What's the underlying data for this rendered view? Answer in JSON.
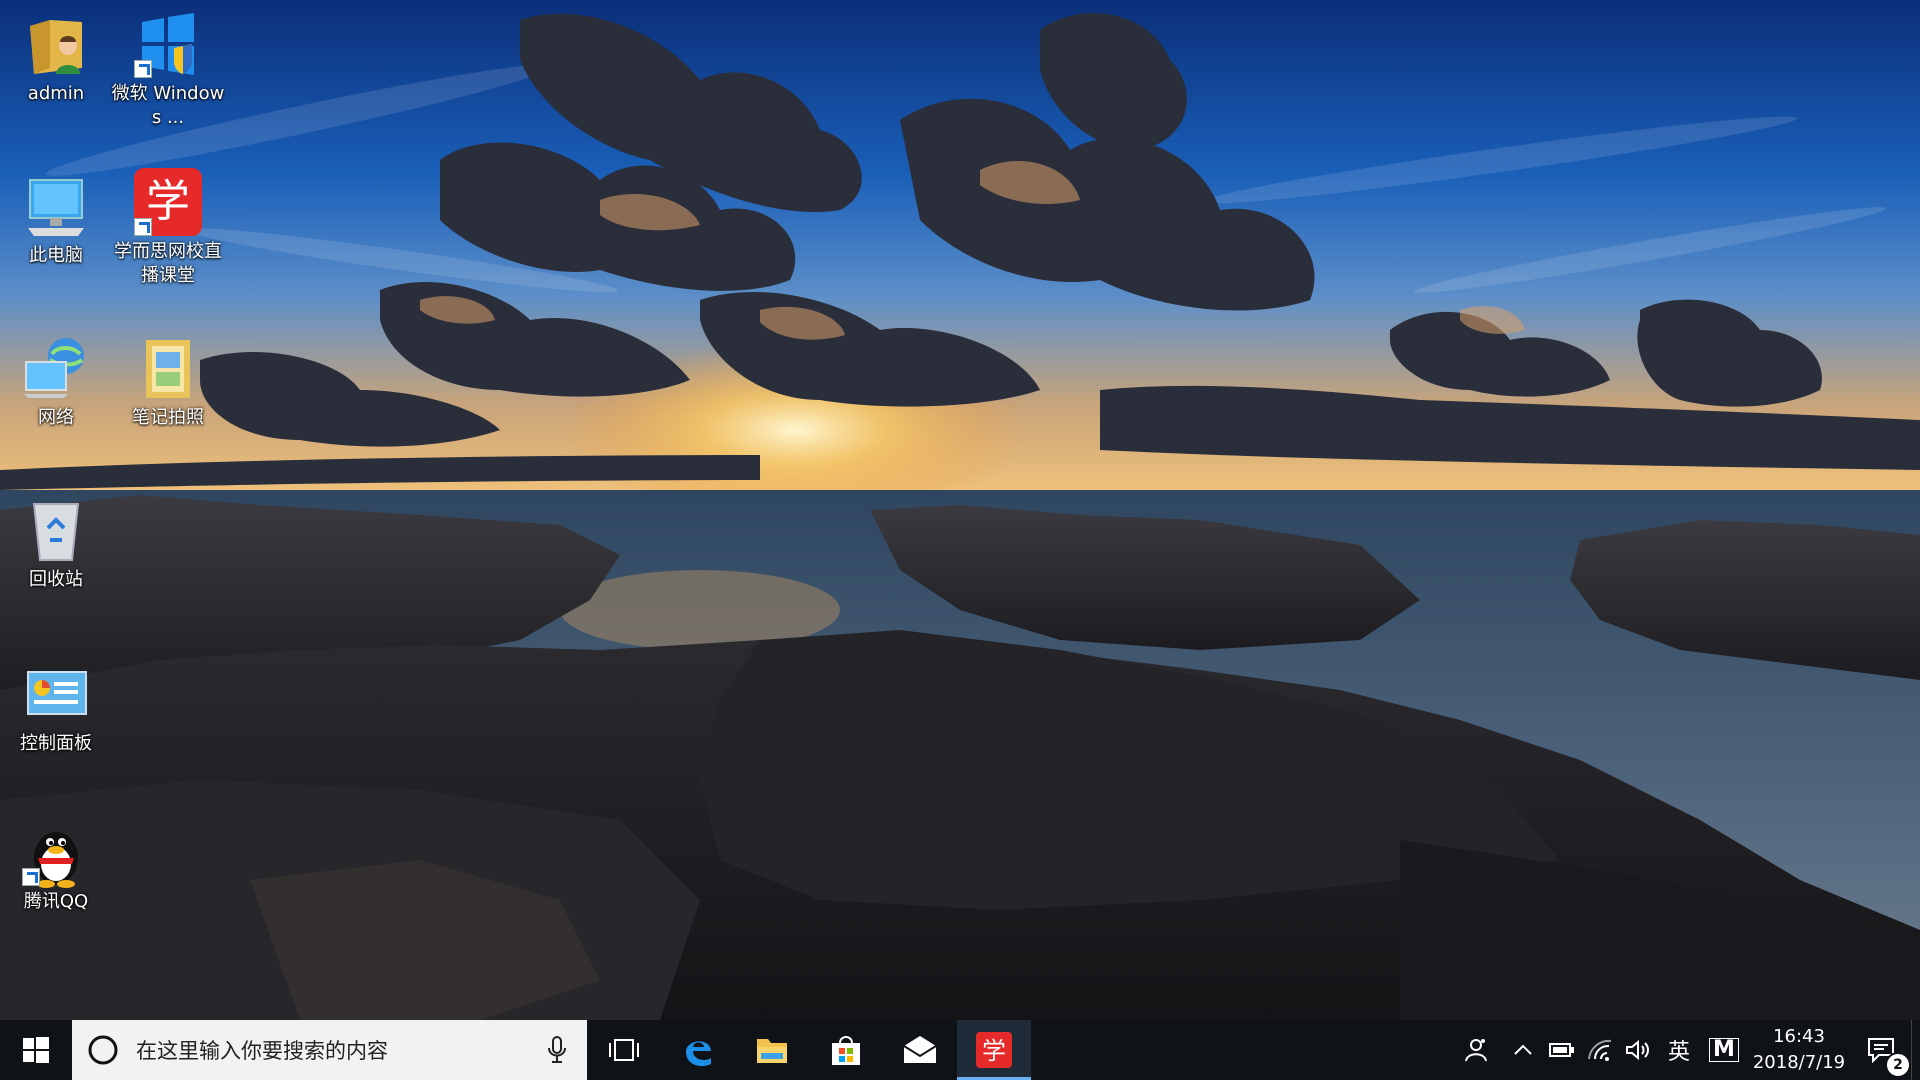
{
  "desktop": {
    "icons": [
      {
        "name": "admin",
        "label": "admin"
      },
      {
        "name": "windows-security",
        "label": "微软 Windows ..."
      },
      {
        "name": "this-pc",
        "label": "此电脑"
      },
      {
        "name": "xueersi",
        "label": "学而思网校直播课堂",
        "glyph": "学"
      },
      {
        "name": "network",
        "label": "网络"
      },
      {
        "name": "note-photo",
        "label": "笔记拍照"
      },
      {
        "name": "recycle-bin",
        "label": "回收站"
      },
      {
        "name": "control-panel",
        "label": "控制面板"
      },
      {
        "name": "qq",
        "label": "腾讯QQ"
      }
    ]
  },
  "taskbar": {
    "search_placeholder": "在这里输入你要搜索的内容",
    "apps": [
      {
        "name": "task-view",
        "icon": "task-view-icon"
      },
      {
        "name": "edge",
        "icon": "edge-icon"
      },
      {
        "name": "file-explorer",
        "icon": "folder-icon"
      },
      {
        "name": "store",
        "icon": "store-icon"
      },
      {
        "name": "mail",
        "icon": "mail-icon"
      },
      {
        "name": "xueersi",
        "icon": "xueersi-icon",
        "glyph": "学",
        "active": true
      }
    ],
    "tray": {
      "ime_label": "英",
      "ime_mode": "M",
      "time": "16:43",
      "date": "2018/7/19",
      "notification_count": "2"
    }
  },
  "colors": {
    "taskbar_bg": "#0f1318",
    "accent": "#6ab0f3",
    "xueersi_red": "#e62a2a"
  }
}
